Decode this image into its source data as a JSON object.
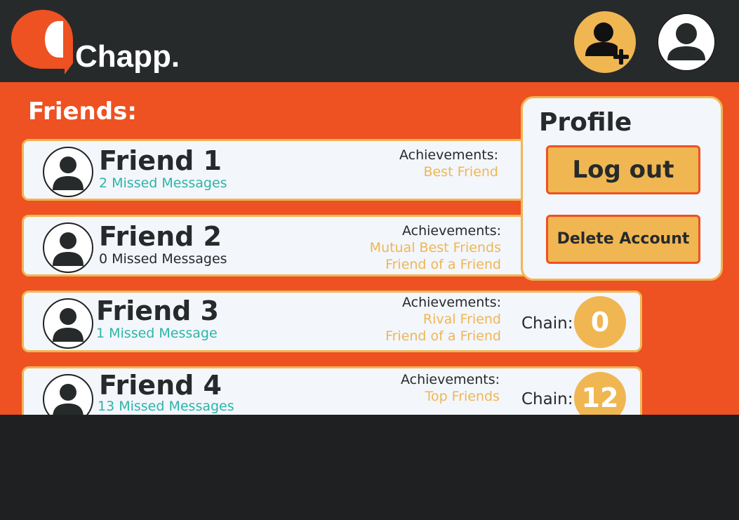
{
  "app": {
    "name": "Chapp."
  },
  "colors": {
    "accent": "#ee5122",
    "gold": "#efb652",
    "dark": "#262a2b",
    "teal": "#2bb5a8",
    "card": "#f3f6fb"
  },
  "header": {
    "add_friend_icon": "add-user-icon",
    "profile_icon": "user-icon"
  },
  "friends_section": {
    "title": "Friends:",
    "friends": [
      {
        "name": "Friend 1",
        "missed": "2 Missed Messages",
        "achievements_label": "Achievements:",
        "achievements": [
          "Best Friend"
        ]
      },
      {
        "name": "Friend 2",
        "missed": "0 Missed Messages",
        "achievements_label": "Achievements:",
        "achievements": [
          "Mutual Best Friends",
          "Friend of a Friend"
        ]
      },
      {
        "name": "Friend 3",
        "missed": "1 Missed Message",
        "achievements_label": "Achievements:",
        "achievements": [
          "Rival Friend",
          "Friend of a Friend"
        ],
        "chain_label": "Chain:",
        "chain": "0"
      },
      {
        "name": "Friend 4",
        "missed": "13 Missed Messages",
        "achievements_label": "Achievements:",
        "achievements": [
          "Top Friends"
        ],
        "chain_label": "Chain:",
        "chain": "12"
      }
    ]
  },
  "profile_panel": {
    "title": "Profile",
    "logout": "Log out",
    "delete": "Delete Account"
  }
}
